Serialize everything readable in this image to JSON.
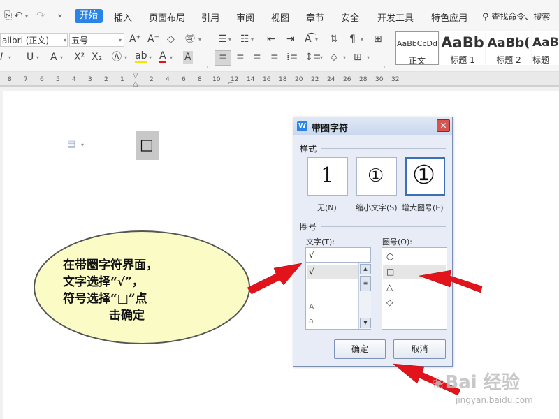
{
  "menubar": {
    "tabs": [
      "开始",
      "插入",
      "页面布局",
      "引用",
      "审阅",
      "视图",
      "章节",
      "安全",
      "开发工具",
      "特色应用"
    ],
    "search_label": "查找命令、搜索"
  },
  "ribbon": {
    "font_name": "alibri (正文)",
    "font_size": "五号",
    "styles": [
      {
        "preview": "AaBbCcDd",
        "name": "正文"
      },
      {
        "preview": "AaBb",
        "name": "标题 1"
      },
      {
        "preview": "AaBb(",
        "name": "标题 2"
      },
      {
        "preview": "AaBb",
        "name": "标题"
      }
    ]
  },
  "ruler": {
    "numbers": [
      "8",
      "7",
      "6",
      "5",
      "4",
      "3",
      "2",
      "1",
      "2",
      "4",
      "6",
      "8",
      "10",
      "12",
      "14",
      "16",
      "18",
      "20",
      "22",
      "24",
      "26",
      "28",
      "30",
      "32"
    ]
  },
  "document": {
    "inserted_char": "□"
  },
  "dialog": {
    "title": "带圈字符",
    "style_group": "样式",
    "options": [
      {
        "preview": "1",
        "label": "无(N)"
      },
      {
        "preview": "①",
        "label": "缩小文字(S)"
      },
      {
        "preview": "①",
        "label": "增大圈号(E)"
      }
    ],
    "enclose_group": "圈号",
    "text_label": "文字(T):",
    "text_value": "√",
    "text_items": [
      "√",
      "",
      "",
      "A",
      "a"
    ],
    "shape_label": "圈号(O):",
    "shape_items": [
      "○",
      "□",
      "△",
      "◇"
    ],
    "ok": "确定",
    "cancel": "取消"
  },
  "callout": {
    "lines": [
      "在带圈字符界面，",
      "文字选择“√”，",
      "符号选择“□”点",
      "击确定"
    ]
  },
  "watermark": {
    "text": "Bai 经验",
    "url": "jingyan.baidu.com"
  },
  "colors": {
    "accent": "#2a83e6",
    "bubble_fill": "#fbfbc6",
    "arrow": "#e3131b",
    "dialog_bg": "#e7ecf6",
    "close_btn": "#d9534f"
  }
}
